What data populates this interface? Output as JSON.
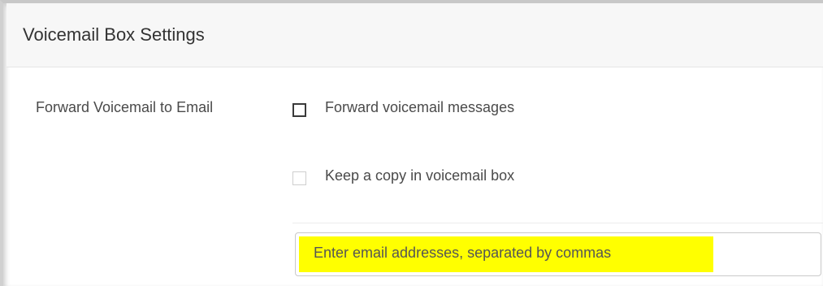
{
  "header": {
    "title": "Voicemail Box Settings"
  },
  "forward_section": {
    "label": "Forward Voicemail to Email",
    "options": [
      {
        "label": "Forward voicemail messages",
        "checked": false,
        "disabled": false
      },
      {
        "label": "Keep a copy in voicemail box",
        "checked": false,
        "disabled": true
      }
    ],
    "email_input": {
      "value": "",
      "placeholder": "Enter email addresses, separated by commas",
      "highlight_color": "#ffff00"
    }
  }
}
